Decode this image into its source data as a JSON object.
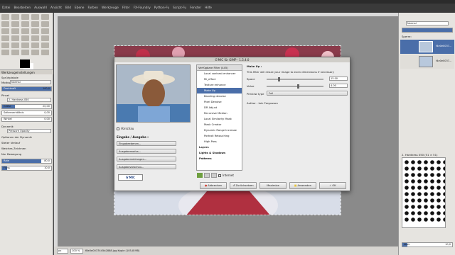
{
  "menubar": {
    "items": [
      "Datei",
      "Bearbeiten",
      "Auswahl",
      "Ansicht",
      "Bild",
      "Ebene",
      "Farben",
      "Werkzeuge",
      "Filter",
      "FX-Foundry",
      "Python-Fu",
      "Script-Fu",
      "Fenster",
      "Hilfe"
    ]
  },
  "toolbox": {
    "options_title": "Werkzeugeinstellungen",
    "tool_name": "Sprühpistole",
    "mode_label": "Modus:",
    "mode_value": "Normal",
    "opacity_label": "Deckkraft",
    "opacity_value": "100,0",
    "brush_label": "Pinsel",
    "brush_value": "2. Hardness 050",
    "size_label": "Größe",
    "size_value": "20,00",
    "ratio_label": "Seitenverhältnis",
    "ratio_value": "0,00",
    "angle_label": "Winkel",
    "angle_value": "0,00",
    "dynamics_label": "Dynamik",
    "dynamics_value": "Pressure Opacity",
    "dyn_opt": "Optionen der Dynamik",
    "opt1": "Steter Verlauf",
    "opt2": "Weiches Zeichnen",
    "opt3": "Nur Bewegung",
    "rate_label": "Rate",
    "rate_value": "80,0",
    "flow_label": "Fluss",
    "flow_value": "10,0"
  },
  "dialog": {
    "title": "G'MIC für GIMP - 1.5.4.0",
    "preview_label": "Vorschau",
    "io_label": "Eingabe / Ausgabe :",
    "io_items": [
      "Eingabeebenen...",
      "Ausgabemodus...",
      "Ausgabemeldungen...",
      "Ausgabevorschau..."
    ],
    "logo_text": "G'MIC",
    "filters_header": "Verfügbare Filter (445)",
    "filters": [
      {
        "label": "Local contrast enhancer",
        "selected": false,
        "cat": false
      },
      {
        "label": "Mi_effect",
        "selected": false,
        "cat": false
      },
      {
        "label": "Texture enhance",
        "selected": false,
        "cat": false
      },
      {
        "label": "Make Up",
        "selected": true,
        "cat": false
      },
      {
        "label": "Banding denoise",
        "selected": false,
        "cat": false
      },
      {
        "label": "Pixel Denoise",
        "selected": false,
        "cat": false
      },
      {
        "label": "DR Adjust",
        "selected": false,
        "cat": false
      },
      {
        "label": "Recursive Median",
        "selected": false,
        "cat": false
      },
      {
        "label": "Local Similarity Mask",
        "selected": false,
        "cat": false
      },
      {
        "label": "Mask Creator",
        "selected": false,
        "cat": false
      },
      {
        "label": "Dynamic Range Increase",
        "selected": false,
        "cat": false
      },
      {
        "label": "Portrait Retouching",
        "selected": false,
        "cat": false
      },
      {
        "label": "High Pass",
        "selected": false,
        "cat": false
      },
      {
        "label": "Layers",
        "selected": false,
        "cat": true
      },
      {
        "label": "Lights & Shadows",
        "selected": false,
        "cat": true
      },
      {
        "label": "Patterns",
        "selected": false,
        "cat": true
      }
    ],
    "internet_label": "Internet",
    "settings": {
      "heading": "Make Up :",
      "description": "This filter will resize your image to even dimensions if necessary",
      "space_label": "Space",
      "space_value": "15.00",
      "space_frac": 0.2,
      "value_label": "Value",
      "value_value": "4.00",
      "value_frac": 0.55,
      "preview_type_label": "Preview type",
      "preview_type_value": "Full",
      "author": "Author : Iain Fergusson"
    },
    "buttons": {
      "cancel": "Abbrechen",
      "reset": "Zurücksetzen",
      "maximize": "Maximize",
      "apply": "Anwenden",
      "ok": "OK"
    }
  },
  "right_panel": {
    "mode_label": "Modus:",
    "mode_value": "Normal",
    "lock_label": "Sperre:",
    "layer1": "f4e0e0037...",
    "layer2": "f4e0e0037...",
    "brushes_label": "2. Hardness 050 (51 × 51)",
    "spacing_label": "Abst.",
    "spacing_value": "10,0"
  },
  "statusbar": {
    "unit": "px",
    "zoom": "100 %",
    "info": "f8e0e0037445b2888.jpg Kopie (105,8 MB)"
  },
  "colors": {
    "selection": "#4a6ea9",
    "apply_icon": "#e8c33a",
    "cancel_icon": "#d03a2c"
  }
}
